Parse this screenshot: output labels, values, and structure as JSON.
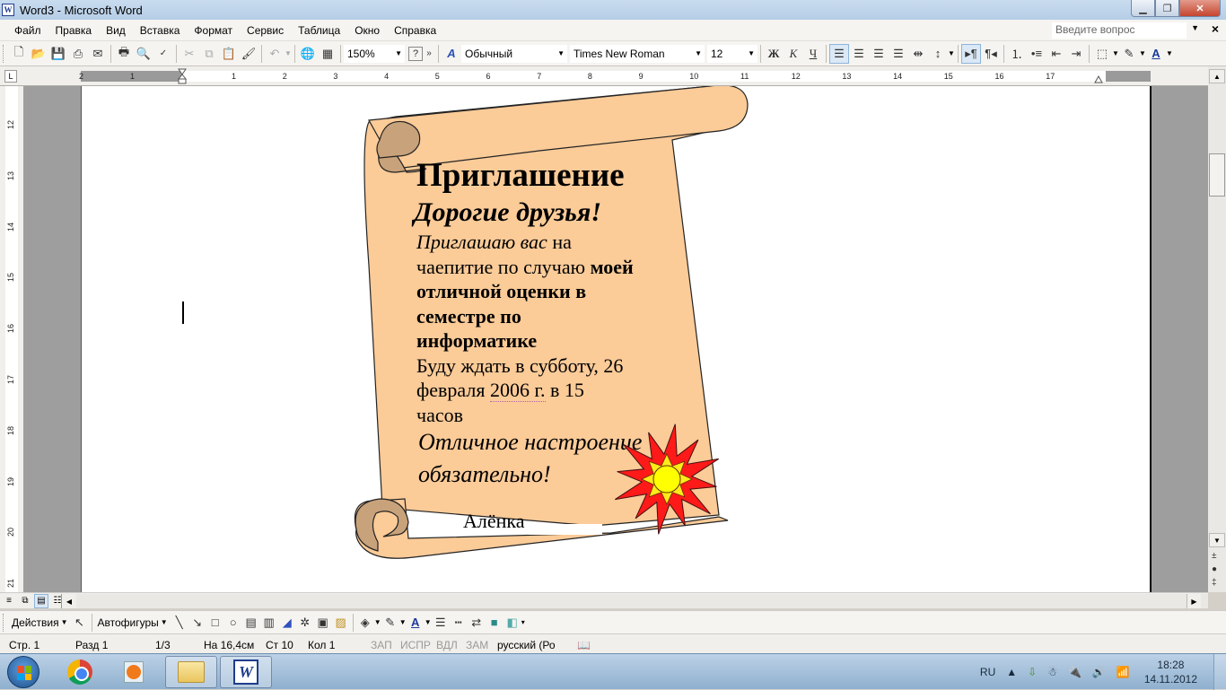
{
  "window": {
    "title": "Word3 - Microsoft Word",
    "app_icon": "word-icon",
    "controls": [
      "minimize",
      "restore",
      "close"
    ]
  },
  "menubar": {
    "items": [
      "Файл",
      "Правка",
      "Вид",
      "Вставка",
      "Формат",
      "Сервис",
      "Таблица",
      "Окно",
      "Справка"
    ],
    "help_placeholder": "Введите вопрос"
  },
  "toolbar": {
    "zoom": "150%",
    "style": "Обычный",
    "font": "Times New Roman",
    "size": "12",
    "bold_label": "Ж",
    "italic_label": "К",
    "underline_label": "Ч",
    "icons": [
      "new-icon",
      "open-icon",
      "save-icon",
      "permission-icon",
      "email-icon",
      "print-icon",
      "print-preview-icon",
      "spelling-icon",
      "cut-icon",
      "copy-icon",
      "paste-icon",
      "format-painter-icon",
      "undo-icon",
      "hyperlink-icon",
      "table-icon",
      "help-icon",
      "more-icon",
      "styles-icon",
      "align-left-icon",
      "align-center-icon",
      "align-right-icon",
      "justify-icon",
      "distributed-icon",
      "line-spacing-icon",
      "ltr-icon",
      "rtl-icon",
      "numbering-icon",
      "bullets-icon",
      "decrease-indent-icon",
      "increase-indent-icon",
      "border-icon",
      "highlight-icon",
      "font-color-icon"
    ]
  },
  "ruler": {
    "h_left": [
      "2",
      "1"
    ],
    "h_numbers": [
      "1",
      "2",
      "3",
      "4",
      "5",
      "6",
      "7",
      "8",
      "9",
      "10",
      "11",
      "12",
      "13",
      "14",
      "15",
      "16",
      "17"
    ],
    "v_numbers": [
      "12",
      "13",
      "14",
      "15",
      "16",
      "17",
      "18",
      "19",
      "20",
      "21"
    ]
  },
  "document": {
    "title": "Приглашение",
    "greeting": "Дорогие друзья!",
    "line1_italic": "Приглашаю вас",
    "line1_rest": " на",
    "line2_normal": "чаепитие по случаю ",
    "line2_bold": "моей",
    "line3": "отличной оценки в",
    "line4": "семестре по",
    "line5": "информатике",
    "line6": "Буду ждать в субботу, 26",
    "line7_a": "февраля ",
    "line7_b": "2006 г.",
    "line7_c": " в 15",
    "line8": "часов",
    "mood1": "Отличное настроение",
    "mood2": "обязательно!",
    "signature": "Алёнка",
    "colors": {
      "scroll_fill": "#fbcb98",
      "scroll_curl": "#c8a27a",
      "star_fill": "#ff1a1a",
      "sun_fill": "#ffff00"
    }
  },
  "drawing_bar": {
    "actions": "Действия",
    "autoshapes": "Автофигуры"
  },
  "status": {
    "page": "Стр. 1",
    "section": "Разд 1",
    "pages": "1/3",
    "at": "На 16,4см",
    "line": "Ст 10",
    "col": "Кол 1",
    "rec": "ЗАП",
    "trk": "ИСПР",
    "ext": "ВДЛ",
    "ovr": "ЗАМ",
    "lang": "русский (Ро"
  },
  "taskbar": {
    "apps": [
      "start",
      "chrome",
      "media-player",
      "explorer",
      "word"
    ],
    "lang": "RU",
    "time": "18:28",
    "date": "14.11.2012"
  }
}
